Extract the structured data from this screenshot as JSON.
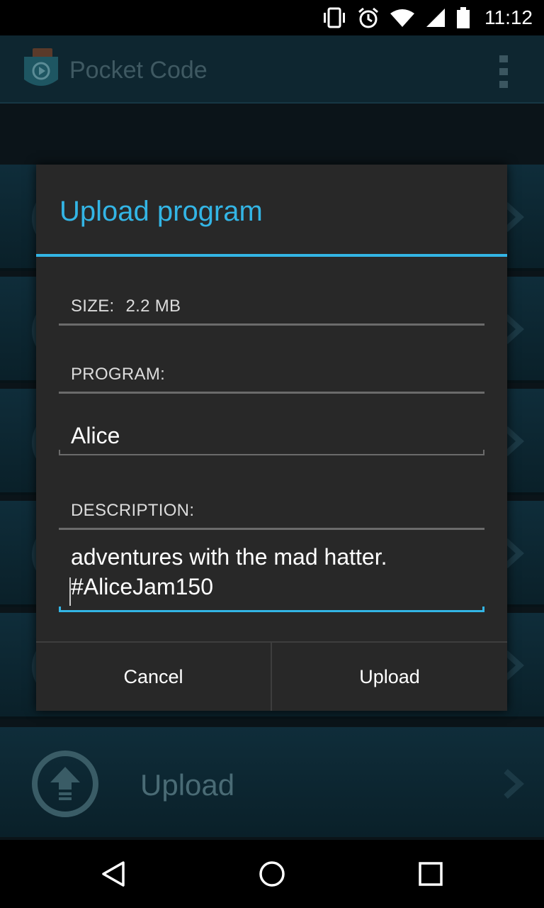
{
  "status_bar": {
    "time": "11:12",
    "icons": [
      "vibrate-icon",
      "alarm-icon",
      "wifi-icon",
      "signal-icon",
      "battery-icon"
    ]
  },
  "action_bar": {
    "title": "Pocket Code",
    "logo_icon": "pocket-code-logo",
    "menu_icon": "overflow-menu-icon"
  },
  "background_list": {
    "upload_label": "Upload"
  },
  "dialog": {
    "title": "Upload program",
    "size_label": "SIZE:",
    "size_value": "2.2 MB",
    "program_label": "PROGRAM:",
    "program_name": "Alice",
    "description_label": "DESCRIPTION:",
    "description_text": "adventures with the mad hatter.\n#AliceJam150",
    "cancel_label": "Cancel",
    "upload_label": "Upload"
  },
  "colors": {
    "accent": "#33b5e5",
    "dialog_background": "#282828",
    "screen_background": "#0b1419"
  },
  "nav_bar": {
    "icons": [
      "back-icon",
      "home-icon",
      "recents-icon"
    ]
  }
}
